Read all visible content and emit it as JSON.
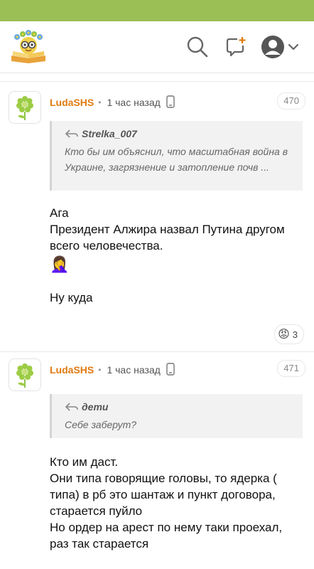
{
  "header": {
    "search_icon": "search-icon",
    "new_post_icon": "new-post-icon",
    "avatar_icon": "user-avatar-icon"
  },
  "comments": [
    {
      "author": "LudaSHS",
      "time": "1 час назад",
      "number": "470",
      "quote": {
        "author": "Strelka_007",
        "lines": [
          "Кто бы им объяснил, что масштабная война в",
          "Украине, загрязнение и затопление почв ..."
        ]
      },
      "body": [
        "Ага",
        "Президент Алжира назвал Путина другом",
        "всего человечества."
      ],
      "emoji": "🤦‍♀️",
      "body_after": "Ну куда",
      "reaction": {
        "emoji": "😡",
        "count": "3"
      }
    },
    {
      "author": "LudaSHS",
      "time": "1 час назад",
      "number": "471",
      "quote": {
        "author": "дети",
        "lines": [
          "Себе заберут?"
        ]
      },
      "body": [
        "Кто им даст.",
        "Они типа говорящие головы, то ядерка (",
        "типа) в рб это шантаж и пункт договора,",
        "старается пуйло",
        "Но ордер на арест по нему таки проехал,",
        "раз так старается"
      ]
    }
  ],
  "colors": {
    "topbar": "#9bbf55",
    "author": "#e07a10"
  }
}
